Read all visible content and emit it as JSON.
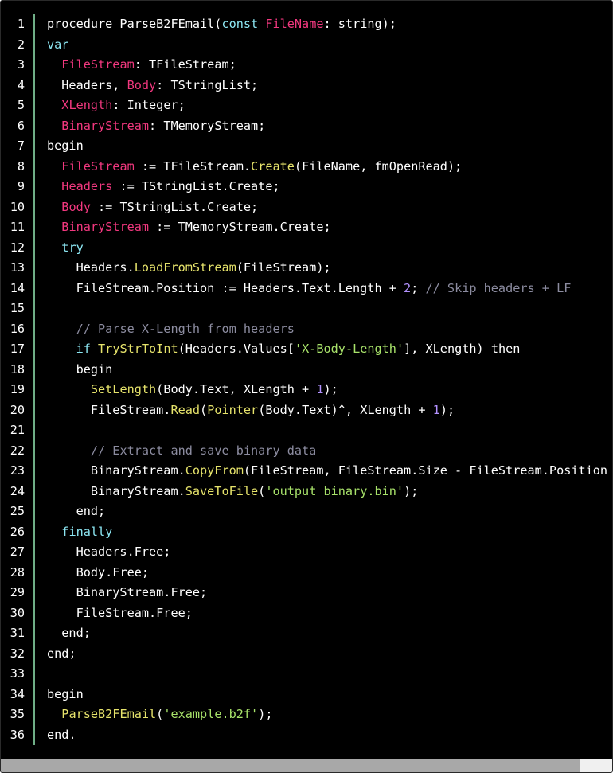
{
  "code": {
    "language": "pascal",
    "colors": {
      "background": "#000000",
      "gutter_bar": "#6fae86",
      "default": "#ffffff",
      "keyword": "#8ce6f2",
      "variable": "#f2387f",
      "function": "#e6e36b",
      "string": "#a8e26a",
      "number": "#b392ff",
      "comment": "#8c8ca0"
    },
    "lines": [
      {
        "n": "1",
        "tokens": [
          [
            "def",
            "procedure ParseB2FEmail("
          ],
          [
            "kw",
            "const"
          ],
          [
            "def",
            " "
          ],
          [
            "var",
            "FileName"
          ],
          [
            "def",
            ": string);"
          ]
        ]
      },
      {
        "n": "2",
        "tokens": [
          [
            "kw",
            "var"
          ]
        ]
      },
      {
        "n": "3",
        "tokens": [
          [
            "def",
            "  "
          ],
          [
            "var",
            "FileStream"
          ],
          [
            "def",
            ": TFileStream;"
          ]
        ]
      },
      {
        "n": "4",
        "tokens": [
          [
            "def",
            "  Headers, "
          ],
          [
            "var",
            "Body"
          ],
          [
            "def",
            ": TStringList;"
          ]
        ]
      },
      {
        "n": "5",
        "tokens": [
          [
            "def",
            "  "
          ],
          [
            "var",
            "XLength"
          ],
          [
            "def",
            ": Integer;"
          ]
        ]
      },
      {
        "n": "6",
        "tokens": [
          [
            "def",
            "  "
          ],
          [
            "var",
            "BinaryStream"
          ],
          [
            "def",
            ": TMemoryStream;"
          ]
        ]
      },
      {
        "n": "7",
        "tokens": [
          [
            "def",
            "begin"
          ]
        ]
      },
      {
        "n": "8",
        "tokens": [
          [
            "def",
            "  "
          ],
          [
            "var",
            "FileStream"
          ],
          [
            "def",
            " := TFileStream."
          ],
          [
            "fn",
            "Create"
          ],
          [
            "def",
            "(FileName, fmOpenRead);"
          ]
        ]
      },
      {
        "n": "9",
        "tokens": [
          [
            "def",
            "  "
          ],
          [
            "var",
            "Headers"
          ],
          [
            "def",
            " := TStringList.Create;"
          ]
        ]
      },
      {
        "n": "10",
        "tokens": [
          [
            "def",
            "  "
          ],
          [
            "var",
            "Body"
          ],
          [
            "def",
            " := TStringList.Create;"
          ]
        ]
      },
      {
        "n": "11",
        "tokens": [
          [
            "def",
            "  "
          ],
          [
            "var",
            "BinaryStream"
          ],
          [
            "def",
            " := TMemoryStream.Create;"
          ]
        ]
      },
      {
        "n": "12",
        "tokens": [
          [
            "def",
            "  "
          ],
          [
            "kw",
            "try"
          ]
        ]
      },
      {
        "n": "13",
        "tokens": [
          [
            "def",
            "    Headers."
          ],
          [
            "fn",
            "LoadFromStream"
          ],
          [
            "def",
            "(FileStream);"
          ]
        ]
      },
      {
        "n": "14",
        "tokens": [
          [
            "def",
            "    FileStream.Position := Headers.Text.Length + "
          ],
          [
            "num",
            "2"
          ],
          [
            "def",
            "; "
          ],
          [
            "com",
            "// Skip headers + LF"
          ]
        ]
      },
      {
        "n": "15",
        "tokens": []
      },
      {
        "n": "16",
        "tokens": [
          [
            "def",
            "    "
          ],
          [
            "com",
            "// Parse X-Length from headers"
          ]
        ]
      },
      {
        "n": "17",
        "tokens": [
          [
            "def",
            "    "
          ],
          [
            "kw",
            "if"
          ],
          [
            "def",
            " "
          ],
          [
            "fn",
            "TryStrToInt"
          ],
          [
            "def",
            "(Headers.Values["
          ],
          [
            "str",
            "'X-Body-Length'"
          ],
          [
            "def",
            "], XLength) then"
          ]
        ]
      },
      {
        "n": "18",
        "tokens": [
          [
            "def",
            "    begin"
          ]
        ]
      },
      {
        "n": "19",
        "tokens": [
          [
            "def",
            "      "
          ],
          [
            "fn",
            "SetLength"
          ],
          [
            "def",
            "(Body.Text, XLength + "
          ],
          [
            "num",
            "1"
          ],
          [
            "def",
            ");"
          ]
        ]
      },
      {
        "n": "20",
        "tokens": [
          [
            "def",
            "      FileStream."
          ],
          [
            "fn",
            "Read"
          ],
          [
            "def",
            "("
          ],
          [
            "fn",
            "Pointer"
          ],
          [
            "def",
            "(Body.Text)^, XLength + "
          ],
          [
            "num",
            "1"
          ],
          [
            "def",
            ");"
          ]
        ]
      },
      {
        "n": "21",
        "tokens": []
      },
      {
        "n": "22",
        "tokens": [
          [
            "def",
            "      "
          ],
          [
            "com",
            "// Extract and save binary data"
          ]
        ]
      },
      {
        "n": "23",
        "tokens": [
          [
            "def",
            "      BinaryStream."
          ],
          [
            "fn",
            "CopyFrom"
          ],
          [
            "def",
            "(FileStream, FileStream.Size - FileStream.Position"
          ]
        ]
      },
      {
        "n": "24",
        "tokens": [
          [
            "def",
            "      BinaryStream."
          ],
          [
            "fn",
            "SaveToFile"
          ],
          [
            "def",
            "("
          ],
          [
            "str",
            "'output_binary.bin'"
          ],
          [
            "def",
            ");"
          ]
        ]
      },
      {
        "n": "25",
        "tokens": [
          [
            "def",
            "    end;"
          ]
        ]
      },
      {
        "n": "26",
        "tokens": [
          [
            "def",
            "  "
          ],
          [
            "kw",
            "finally"
          ]
        ]
      },
      {
        "n": "27",
        "tokens": [
          [
            "def",
            "    Headers.Free;"
          ]
        ]
      },
      {
        "n": "28",
        "tokens": [
          [
            "def",
            "    Body.Free;"
          ]
        ]
      },
      {
        "n": "29",
        "tokens": [
          [
            "def",
            "    BinaryStream.Free;"
          ]
        ]
      },
      {
        "n": "30",
        "tokens": [
          [
            "def",
            "    FileStream.Free;"
          ]
        ]
      },
      {
        "n": "31",
        "tokens": [
          [
            "def",
            "  end;"
          ]
        ]
      },
      {
        "n": "32",
        "tokens": [
          [
            "def",
            "end;"
          ]
        ]
      },
      {
        "n": "33",
        "tokens": []
      },
      {
        "n": "34",
        "tokens": [
          [
            "def",
            "begin"
          ]
        ]
      },
      {
        "n": "35",
        "tokens": [
          [
            "def",
            "  "
          ],
          [
            "fn",
            "ParseB2FEmail"
          ],
          [
            "def",
            "("
          ],
          [
            "str",
            "'example.b2f'"
          ],
          [
            "def",
            ");"
          ]
        ]
      },
      {
        "n": "36",
        "tokens": [
          [
            "def",
            "end."
          ]
        ]
      }
    ]
  }
}
